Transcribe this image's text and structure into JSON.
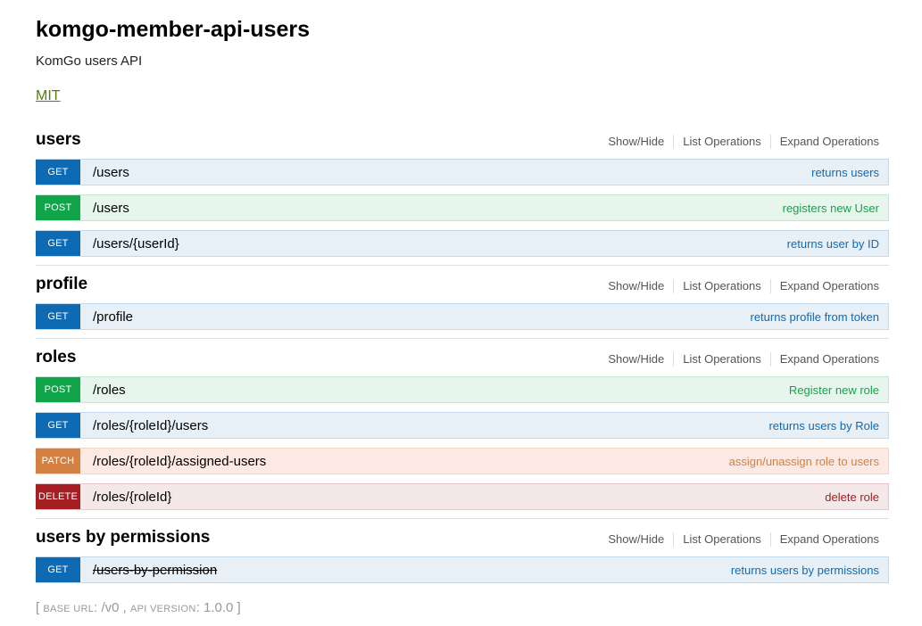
{
  "info": {
    "title": "komgo-member-api-users",
    "description": "KomGo users API",
    "license": "MIT"
  },
  "actions": {
    "show_hide": "Show/Hide",
    "list_operations": "List Operations",
    "expand_operations": "Expand Operations"
  },
  "resources": [
    {
      "name": "users",
      "operations": [
        {
          "method": "GET",
          "path": "/users",
          "summary": "returns users"
        },
        {
          "method": "POST",
          "path": "/users",
          "summary": "registers new User"
        },
        {
          "method": "GET",
          "path": "/users/{userId}",
          "summary": "returns user by ID"
        }
      ]
    },
    {
      "name": "profile",
      "operations": [
        {
          "method": "GET",
          "path": "/profile",
          "summary": "returns profile from token"
        }
      ]
    },
    {
      "name": "roles",
      "operations": [
        {
          "method": "POST",
          "path": "/roles",
          "summary": "Register new role"
        },
        {
          "method": "GET",
          "path": "/roles/{roleId}/users",
          "summary": "returns users by Role"
        },
        {
          "method": "PATCH",
          "path": "/roles/{roleId}/assigned-users",
          "summary": "assign/unassign role to users"
        },
        {
          "method": "DELETE",
          "path": "/roles/{roleId}",
          "summary": "delete role"
        }
      ]
    },
    {
      "name": "users by permissions",
      "operations": [
        {
          "method": "GET",
          "path": "/users-by-permission",
          "summary": "returns users by permissions",
          "deprecated": true
        }
      ]
    }
  ],
  "footer": {
    "open": "[",
    "base_url_label": "Base URL",
    "base_url": "/v0",
    "api_version_label": "API Version",
    "api_version": "1.0.0",
    "close": "]"
  },
  "colors": {
    "get": "#0f6ab4",
    "post": "#10a54a",
    "patch": "#d38042",
    "delete": "#a41e22",
    "license_link": "#547f00"
  }
}
